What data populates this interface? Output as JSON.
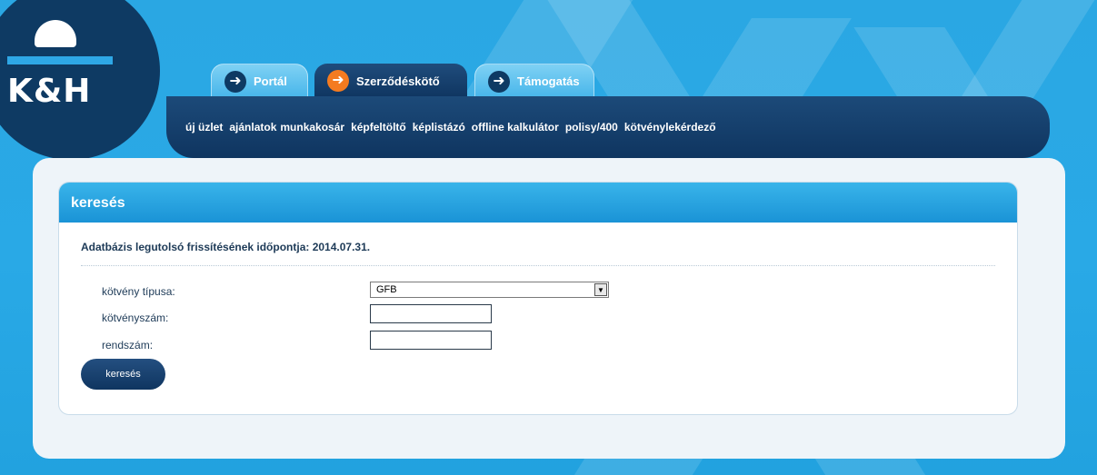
{
  "brand": {
    "logo_text": "K&H"
  },
  "tabs": [
    {
      "label": "Portál",
      "active": false
    },
    {
      "label": "Szerződéskötő",
      "active": true
    },
    {
      "label": "Támogatás",
      "active": false
    }
  ],
  "nav": {
    "items": [
      "új üzlet",
      "ajánlatok",
      "munkakosár",
      "képfeltöltő",
      "képlistázó",
      "offline kalkulátor",
      "polisy/400",
      "kötvénylekérdező"
    ]
  },
  "search": {
    "title": "keresés",
    "db_update": "Adatbázis legutolsó frissítésének időpontja: 2014.07.31.",
    "policy_type_label": "kötvény típusa:",
    "policy_type_value": "GFB",
    "policy_number_label": "kötvényszám:",
    "policy_number_value": "",
    "plate_label": "rendszám:",
    "plate_value": "",
    "button_label": "keresés"
  },
  "colors": {
    "brand_navy": "#0e3a63",
    "brand_blue": "#2aa7e3",
    "accent_orange": "#f47b20"
  }
}
